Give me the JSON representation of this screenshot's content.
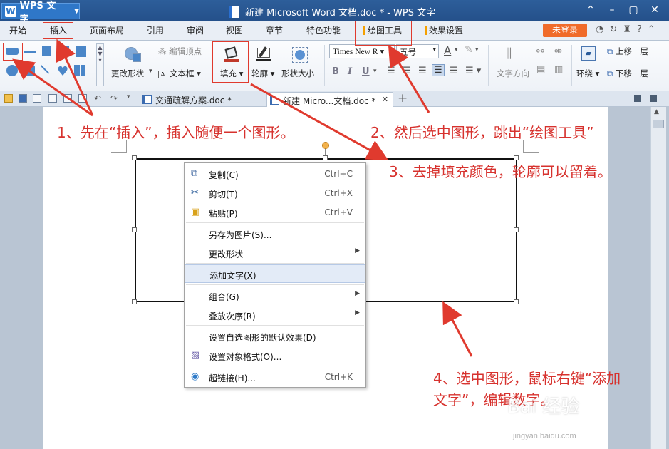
{
  "titlebar": {
    "app_button": "WPS 文字",
    "window_title": "新建 Microsoft Word 文档.doc * - WPS 文字"
  },
  "tabs": {
    "items": [
      "开始",
      "插入",
      "页面布局",
      "引用",
      "审阅",
      "视图",
      "章节",
      "特色功能",
      "绘图工具",
      "效果设置"
    ],
    "login": "未登录"
  },
  "ribbon": {
    "edit_points": "编辑顶点",
    "change_shape": "更改形状",
    "text_box": "文本框",
    "fill": "填充",
    "outline": "轮廓",
    "shape_size": "形状大小",
    "font_name": "Times New R",
    "font_size": "五号",
    "text_direction": "文字方向",
    "wrap": "环绕",
    "bring_forward": "上移一层",
    "send_backward": "下移一层"
  },
  "doc_tabs": {
    "tab1": "交通疏解方案.doc *",
    "tab2": "新建 Micro...文档.doc *"
  },
  "context_menu": [
    {
      "label": "复制(C)",
      "shortcut": "Ctrl+C",
      "icon": "copy-icon"
    },
    {
      "label": "剪切(T)",
      "shortcut": "Ctrl+X",
      "icon": "scissors-icon"
    },
    {
      "label": "粘贴(P)",
      "shortcut": "Ctrl+V",
      "icon": "paste-icon"
    },
    {
      "label": "另存为图片(S)..."
    },
    {
      "label": "更改形状",
      "submenu": true
    },
    {
      "label": "添加文字(X)",
      "highlighted": true
    },
    {
      "label": "组合(G)",
      "submenu": true
    },
    {
      "label": "叠放次序(R)",
      "submenu": true
    },
    {
      "label": "设置自选图形的默认效果(D)"
    },
    {
      "label": "设置对象格式(O)...",
      "icon": "format-object-icon"
    },
    {
      "label": "超链接(H)...",
      "shortcut": "Ctrl+K",
      "icon": "hyperlink-icon"
    }
  ],
  "annotations": {
    "step1": "1、先在“插入”，插入随便一个图形。",
    "step2": "2、然后选中图形，跳出“绘图工具”",
    "step3": "3、去掉填充颜色，轮廓可以留着。",
    "step4_line1": "4、选中图形，鼠标右键“添加",
    "step4_line2": "文字”，编辑数字。"
  },
  "watermark": {
    "text": "Bai 经验",
    "url": "jingyan.baidu.com"
  },
  "colors": {
    "annotation": "#d7322e",
    "titlebar": "#2d5e9a",
    "accent": "#f4a000"
  }
}
